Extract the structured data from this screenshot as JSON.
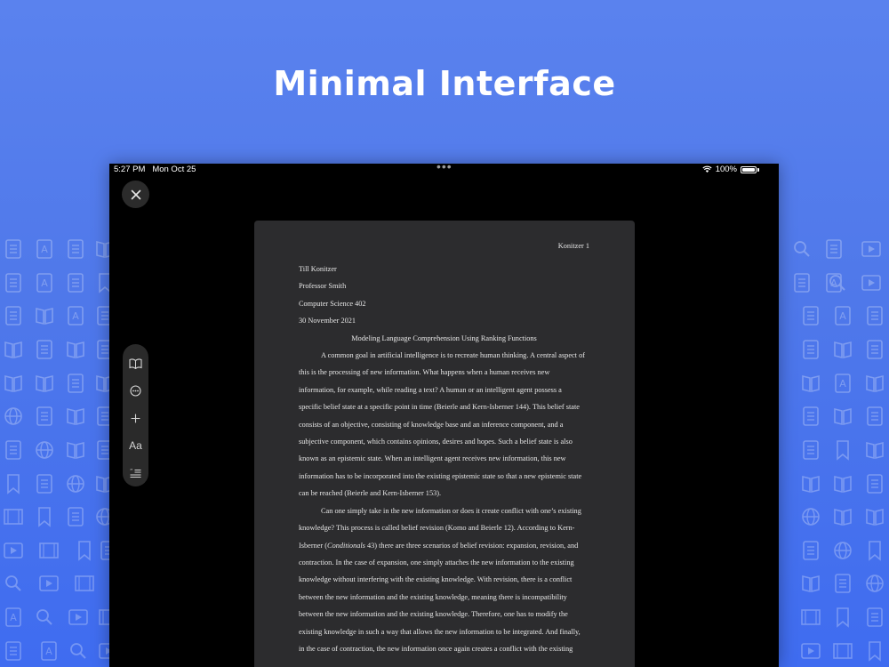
{
  "headline": "Minimal Interface",
  "status_bar": {
    "time": "5:27 PM",
    "date": "Mon Oct 25",
    "multitask_dots": "•••",
    "battery_percent": "100%",
    "icons": [
      "wifi-icon",
      "battery-icon"
    ]
  },
  "toolbar": {
    "close_icon": "close-icon",
    "items": [
      {
        "icon": "book-icon"
      },
      {
        "icon": "more-icon"
      },
      {
        "icon": "plus-icon"
      },
      {
        "icon": "font-icon",
        "label": "Aa"
      },
      {
        "icon": "quote-list-icon"
      }
    ]
  },
  "document": {
    "header": "Konitzer 1",
    "author": "Till Konitzer",
    "instructor": "Professor Smith",
    "course": "Computer Science 402",
    "date": "30 November 2021",
    "title": "Modeling Language Comprehension Using Ranking Functions",
    "paragraph1_lines": [
      "A common goal in artificial intelligence is to recreate human thinking. A central aspect of",
      "this is the processing of new information. What happens when a human receives new",
      "information, for example, while reading a text? A human or an intelligent agent possess a",
      "specific belief state at a specific point in time (Beierle and Kern-Isberner 144). This belief state",
      "consists of an objective, consisting of knowledge base and an inference component, and a",
      "subjective component, which contains opinions, desires and hopes. Such a belief state is also",
      "known as an epistemic state. When an intelligent agent receives new information, this new",
      "information has to be incorporated into the existing epistemic state so that a new epistemic state",
      "can be reached (Beierle and Kern-Isberner 153)."
    ],
    "paragraph2": {
      "line1": "Can one simply take in the new information or does it create conflict with one’s existing",
      "line2": "knowledge? This process is called belief revision (Komo and Beierle 12). According to Kern-",
      "line3_pre": "Isberner (",
      "line3_italic": "Conditionals",
      "line3_post": " 43) there are three scenarios of belief revision: expansion, revision, and",
      "rest_lines": [
        "contraction. In the case of expansion, one simply attaches the new information to the existing",
        "knowledge without interfering with the existing knowledge. With revision, there is a conflict",
        "between the new information and the existing knowledge, meaning there is incompatibility",
        "between the new information and the existing knowledge. Therefore, one has to modify the",
        "existing knowledge in such a way that allows the new information to be integrated. And finally,",
        "in the case of contraction, the new information once again creates a conflict with the existing"
      ]
    }
  },
  "colors": {
    "background_top": "#5a82ee",
    "background_bottom": "#3f6cf0",
    "device": "#000000",
    "page": "#2c2c2e",
    "toolbar": "#2a2a2a",
    "text": "#e6e6e6"
  }
}
